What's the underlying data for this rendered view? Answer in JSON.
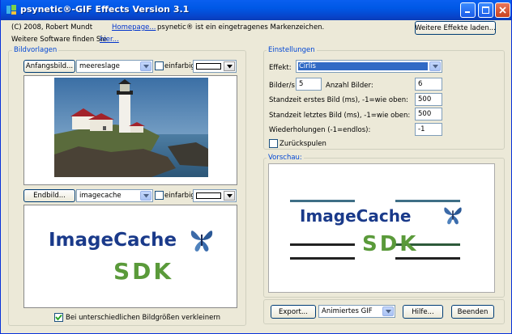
{
  "window": {
    "title": "psynetic®-GIF Effects Version 3.1"
  },
  "info": {
    "copyright": "(C) 2008, Robert Mundt",
    "homepage_link": "Homepage...",
    "trademark": "psynetic® ist ein eingetragenes Markenzeichen.",
    "more_software": "Weitere Software finden Sie",
    "here_link": "hier..."
  },
  "more_effects_button": "Weitere Effekte laden...",
  "source_group": {
    "label": "Bildvorlagen",
    "start": {
      "button": "Anfangsbild...",
      "combo": "meereslage",
      "checkbox_label": "einfarbig"
    },
    "end": {
      "button": "Endbild...",
      "combo": "imagecache",
      "checkbox_label": "einfarbig"
    },
    "logo_text": "ImageCache",
    "logo_sdk": "SDK",
    "shrink_checkbox": "Bei unterschiedlichen Bildgrößen verkleinern"
  },
  "settings": {
    "label": "Einstellungen",
    "effect_label": "Effekt:",
    "effect_value": "Cirlis",
    "fps_label": "Bilder/s:",
    "fps_value": "5",
    "count_label": "Anzahl Bilder:",
    "count_value": "6",
    "first_label": "Standzeit erstes Bild (ms), -1=wie oben:",
    "first_value": "500",
    "last_label": "Standzeit letztes Bild (ms), -1=wie oben:",
    "last_value": "500",
    "repeat_label": "Wiederholungen (-1=endlos):",
    "repeat_value": "-1",
    "rewind_label": "Zurückspulen"
  },
  "preview": {
    "label": "Vorschau:",
    "logo_text": "ImageCache",
    "logo_sdk": "SDK"
  },
  "bottom": {
    "export_button": "Export...",
    "format_value": "Animiertes GIF",
    "help_button": "Hilfe...",
    "quit_button": "Beenden"
  },
  "colors": {
    "title_bar": "#0058e6",
    "highlight": "#316ac5",
    "group_label": "#0046d5"
  }
}
